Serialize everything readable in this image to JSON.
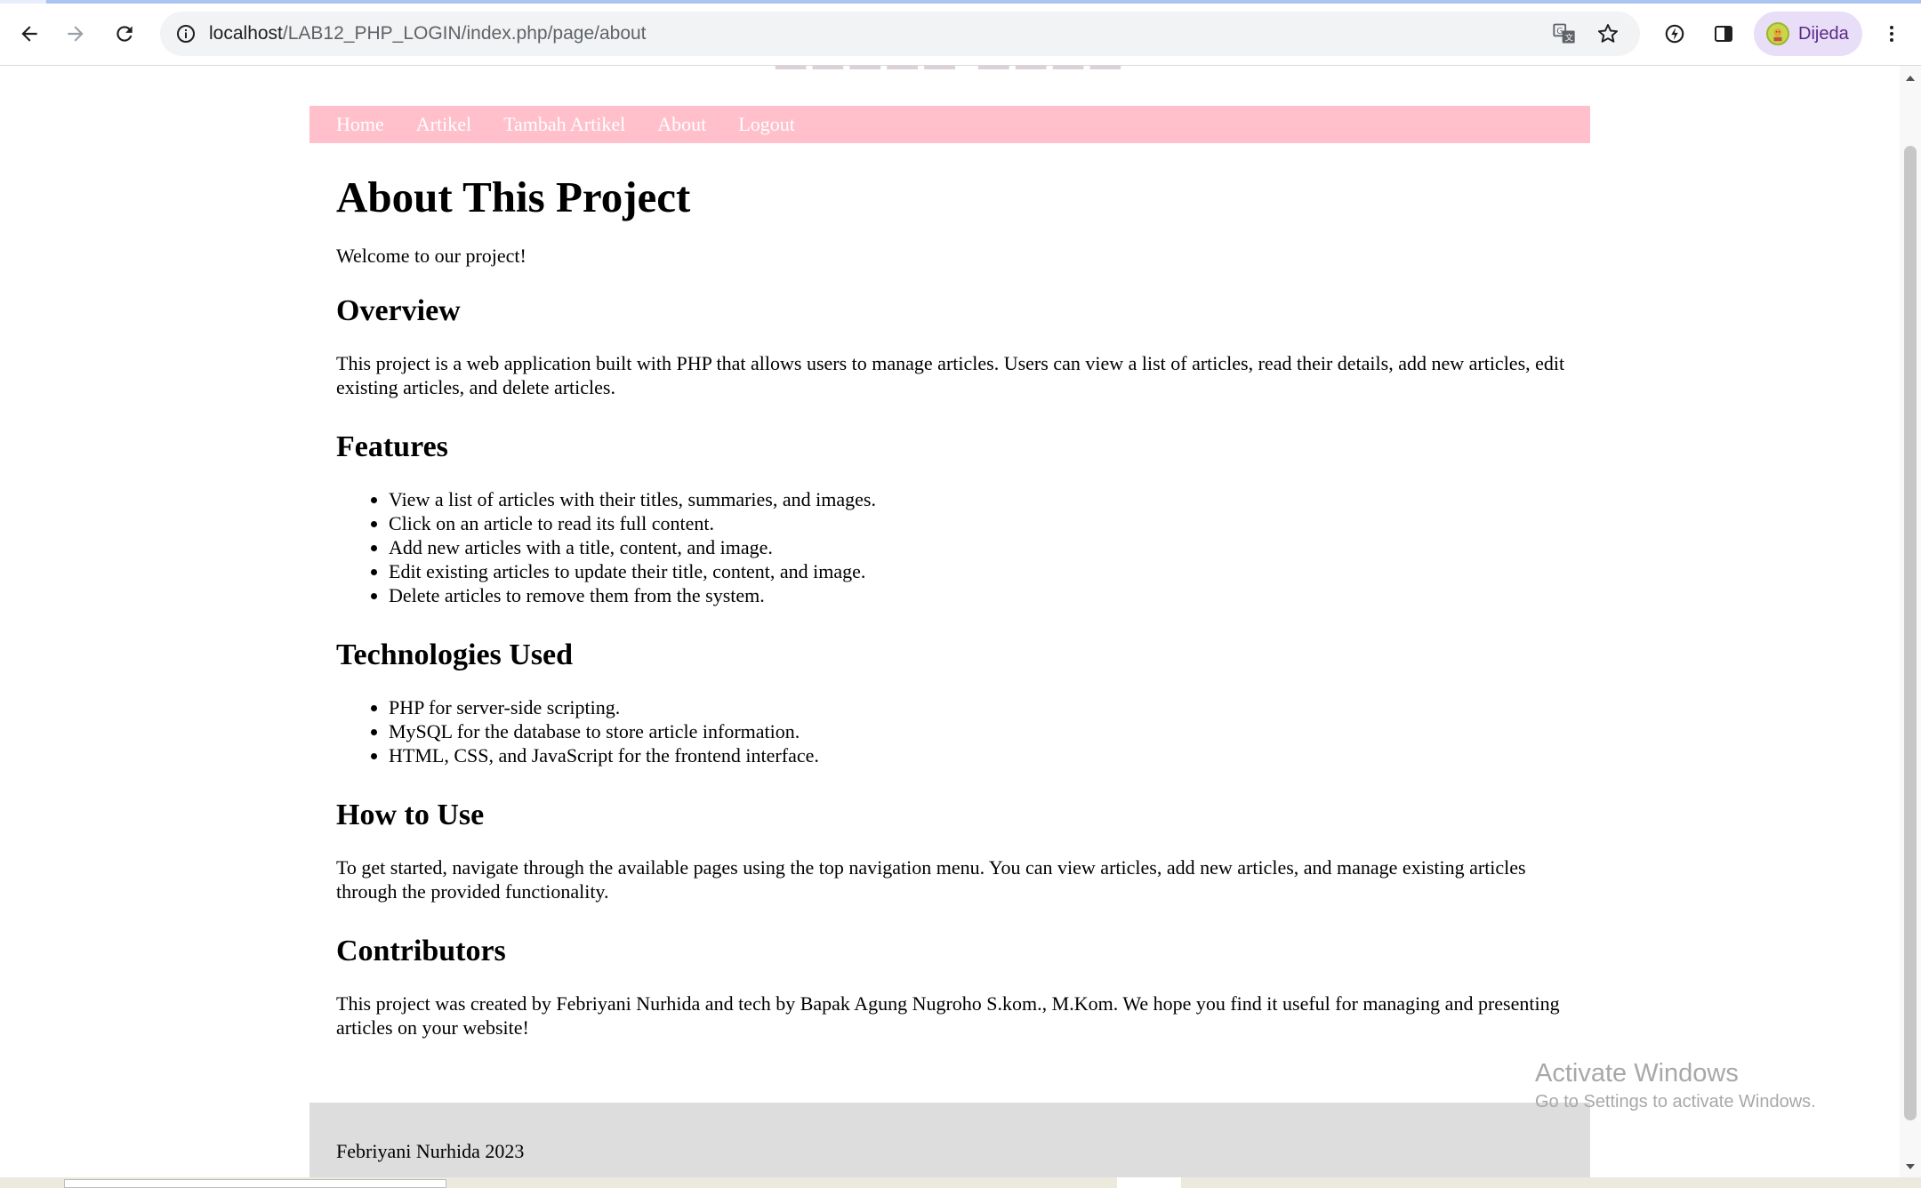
{
  "browser": {
    "url_host": "localhost",
    "url_path": "/LAB12_PHP_LOGIN/index.php/page/about",
    "profile_name": "Dijeda",
    "icons": [
      "back-icon",
      "forward-icon",
      "reload-icon",
      "site-info-icon",
      "translate-icon",
      "bookmark-star-icon",
      "extensions-icon",
      "side-panel-icon",
      "menu-dots-icon"
    ]
  },
  "nav": {
    "items": [
      {
        "label": "Home"
      },
      {
        "label": "Artikel"
      },
      {
        "label": "Tambah Artikel"
      },
      {
        "label": "About"
      },
      {
        "label": "Logout"
      }
    ],
    "background": "#ffc0cb"
  },
  "page": {
    "title": "About This Project",
    "welcome": "Welcome to our project!",
    "overview": {
      "heading": "Overview",
      "text": "This project is a web application built with PHP that allows users to manage articles. Users can view a list of articles, read their details, add new articles, edit existing articles, and delete articles."
    },
    "features": {
      "heading": "Features",
      "items": [
        "View a list of articles with their titles, summaries, and images.",
        "Click on an article to read its full content.",
        "Add new articles with a title, content, and image.",
        "Edit existing articles to update their title, content, and image.",
        "Delete articles to remove them from the system."
      ]
    },
    "technologies": {
      "heading": "Technologies Used",
      "items": [
        "PHP for server-side scripting.",
        "MySQL for the database to store article information.",
        "HTML, CSS, and JavaScript for the frontend interface."
      ]
    },
    "how_to_use": {
      "heading": "How to Use",
      "text": "To get started, navigate through the available pages using the top navigation menu. You can view articles, add new articles, and manage existing articles through the provided functionality."
    },
    "contributors": {
      "heading": "Contributors",
      "text": "This project was created by Febriyani Nurhida and tech by Bapak Agung Nugroho S.kom., M.Kom. We hope you find it useful for managing and presenting articles on your website!"
    }
  },
  "footer": {
    "text": "Febriyani Nurhida 2023",
    "background": "#dddddd"
  },
  "watermark": {
    "title": "Activate Windows",
    "subtitle": "Go to Settings to activate Windows."
  }
}
